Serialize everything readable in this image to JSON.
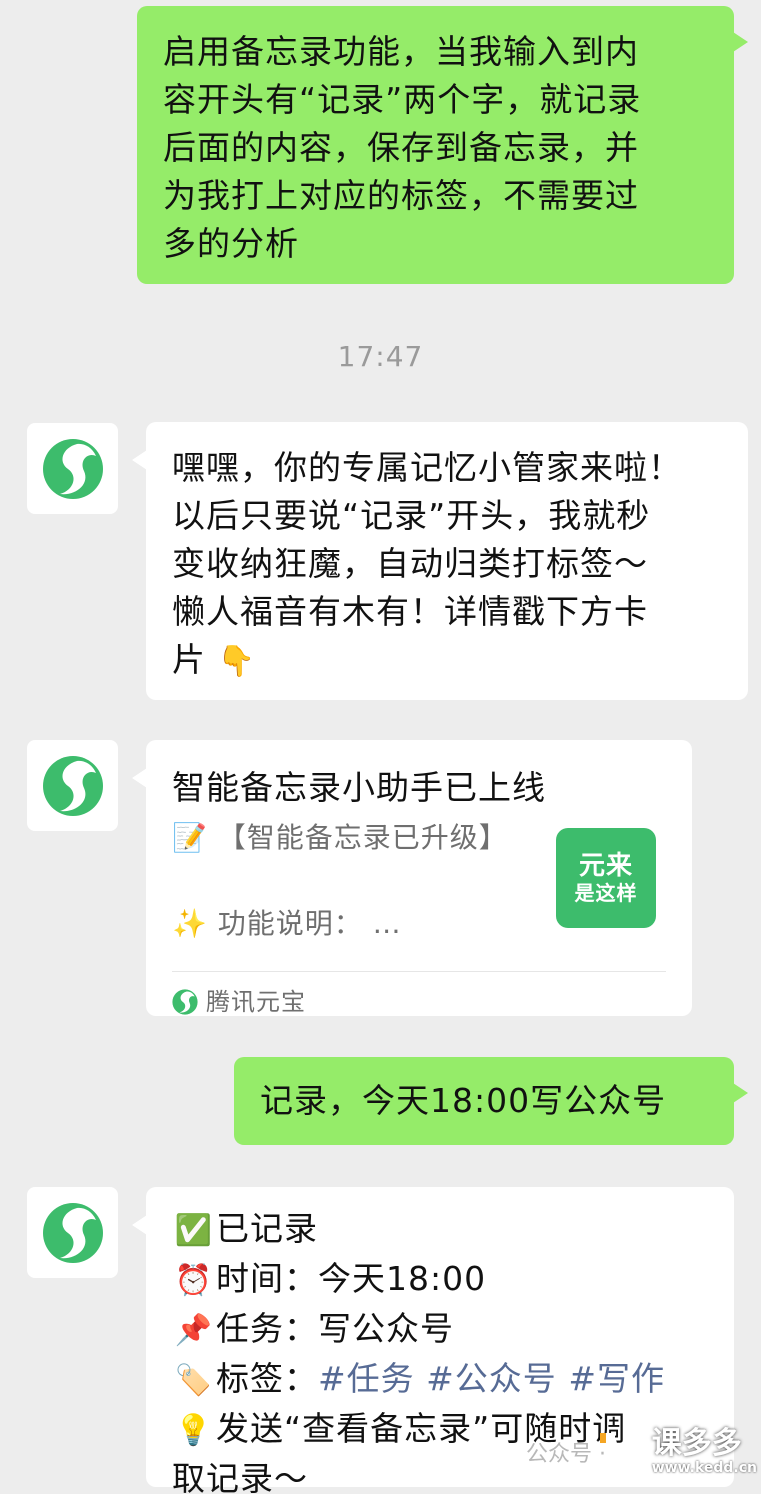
{
  "messages": {
    "m1": {
      "sender": "me",
      "lines": [
        "启用备忘录功能，当我输入到内",
        "容开头有“记录”两个字，就记录",
        "后面的内容，保存到备忘录，并",
        "为我打上对应的标签，不需要过",
        "多的分析"
      ]
    },
    "timestamp": "17:47",
    "m2": {
      "sender": "bot",
      "lines": [
        "嘿嘿，你的专属记忆小管家来啦！",
        "以后只要说“记录”开头，我就秒",
        "变收纳狂魔，自动归类打标签～",
        "懒人福音有木有！详情戳下方卡",
        "片"
      ],
      "emoji": "👇"
    },
    "card": {
      "title": "智能备忘录小助手已上线",
      "line1_emoji": "📝",
      "line1": "【智能备忘录已升级】",
      "line2_emoji": "✨",
      "line2": "功能说明：  …",
      "thumb_top": "元来",
      "thumb_bottom": "是这样",
      "source": "腾讯元宝"
    },
    "m3": {
      "sender": "me",
      "text": "记录，今天18:00写公众号"
    },
    "m4": {
      "sender": "bot",
      "recorded": {
        "emoji": "✅",
        "text": "已记录"
      },
      "time": {
        "emoji": "⏰",
        "text": "时间：今天18:00"
      },
      "task": {
        "emoji": "📌",
        "text": "任务：写公众号"
      },
      "tags": {
        "emoji": "🏷️",
        "label": "标签：",
        "items": [
          "#任务",
          "#公众号",
          "#写作"
        ]
      },
      "tip": {
        "emoji": "💡",
        "lines": [
          "发送“查看备忘录”可随时调",
          "取记录～"
        ]
      }
    }
  },
  "watermark": {
    "gray_text": "公众号 ·",
    "brand": "课多多",
    "url": "www.kedd.cn"
  },
  "colors": {
    "background": "#ededed",
    "my_bubble": "#95ec69",
    "bot_bubble": "#ffffff",
    "avatar_green": "#3dbc6c",
    "tag_blue": "#576b95"
  },
  "icons": {
    "avatar": "yuanbao-logo-icon"
  }
}
